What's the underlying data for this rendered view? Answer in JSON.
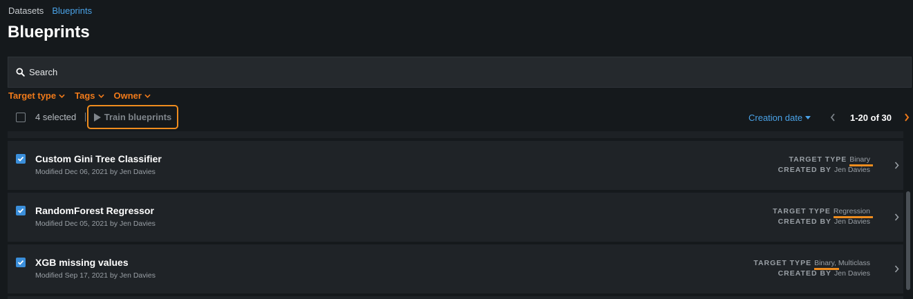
{
  "breadcrumb": {
    "items": [
      {
        "label": "Datasets"
      },
      {
        "label": "Blueprints"
      }
    ]
  },
  "page": {
    "title": "Blueprints"
  },
  "search": {
    "placeholder": "Search"
  },
  "filters": [
    {
      "label": "Target type"
    },
    {
      "label": "Tags"
    },
    {
      "label": "Owner"
    }
  ],
  "toolbar": {
    "selected_text": "4 selected",
    "train_label": "Train blueprints",
    "sort_label": "Creation date",
    "page_range": "1-20 of 30"
  },
  "labels": {
    "target_type": "TARGET TYPE",
    "created_by": "CREATED BY"
  },
  "rows": [
    {
      "title": "Custom Gini Tree Classifier",
      "meta": "Modified Dec 06, 2021 by Jen Davies",
      "target_type": "Binary",
      "created_by": "Jen Davies",
      "checked": true
    },
    {
      "title": "RandomForest Regressor",
      "meta": "Modified Dec 05, 2021 by Jen Davies",
      "target_type": "Regression",
      "created_by": "Jen Davies",
      "checked": true
    },
    {
      "title": "XGB missing values",
      "meta": "Modified Sep 17, 2021 by Jen Davies",
      "target_type_primary": "Binary,",
      "target_type_secondary": " Multiclass",
      "created_by": "Jen Davies",
      "checked": true
    }
  ],
  "icons": {
    "search": "search-icon",
    "dropdown": "chevron-down-icon",
    "play": "play-icon",
    "prev": "chevron-left-icon",
    "next": "chevron-right-icon",
    "check": "check-icon"
  },
  "colors": {
    "accent_orange": "#f07a1a",
    "link_blue": "#4aa3e8",
    "checkbox_blue": "#3b8fdb",
    "background": "#15191c",
    "row_background": "#1f2327"
  }
}
